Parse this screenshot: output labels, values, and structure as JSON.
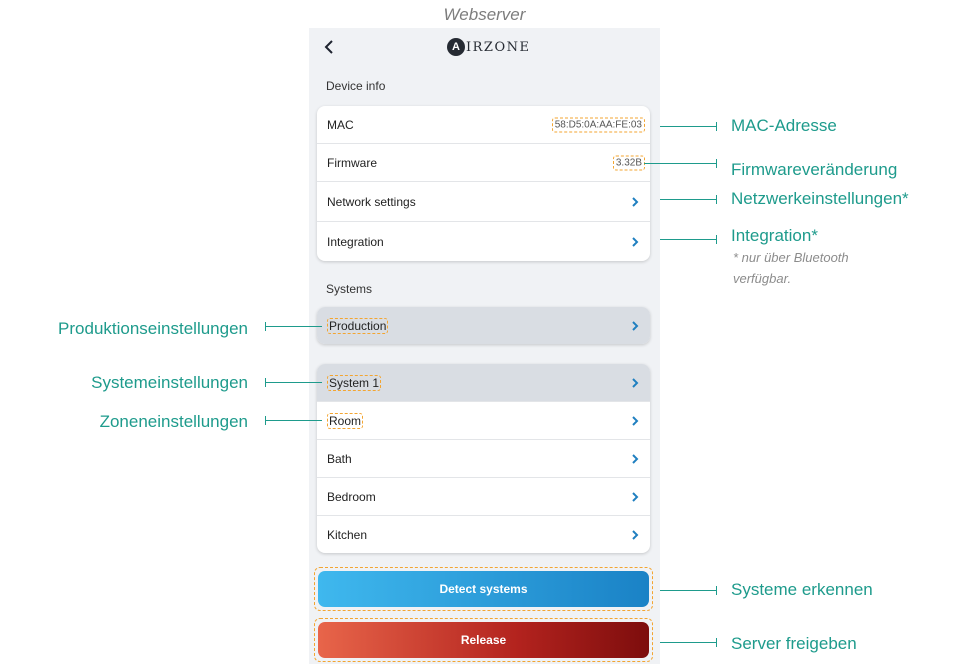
{
  "caption": "Webserver",
  "header": {
    "logo_letter": "A",
    "logo_text": "IRZONE",
    "back_icon": "chevron-left-icon"
  },
  "device_info": {
    "label": "Device info",
    "rows": [
      {
        "label": "MAC",
        "value": "58:D5:0A:AA:FE:03"
      },
      {
        "label": "Firmware",
        "value": "3.32B"
      },
      {
        "label": "Network settings"
      },
      {
        "label": "Integration"
      }
    ]
  },
  "systems": {
    "label": "Systems",
    "production": "Production",
    "list": [
      "System 1",
      "Room",
      "Bath",
      "Bedroom",
      "Kitchen"
    ]
  },
  "buttons": {
    "detect": "Detect systems",
    "release": "Release"
  },
  "annotations": {
    "mac": "MAC-Adresse",
    "firmware": "Firmwareveränderung",
    "network": "Netzwerkeinstellungen*",
    "integration": "Integration*",
    "note_line1": "* nur über Bluetooth",
    "note_line2": "verfügbar.",
    "production": "Produktionseinstellungen",
    "system": "Systemeinstellungen",
    "zone": "Zoneneinstellungen",
    "detect": "Systeme erkennen",
    "release": "Server freigeben"
  },
  "colors": {
    "accent": "#1f7fc0",
    "annotation": "#1e9b8c",
    "highlight": "#f3a531"
  }
}
